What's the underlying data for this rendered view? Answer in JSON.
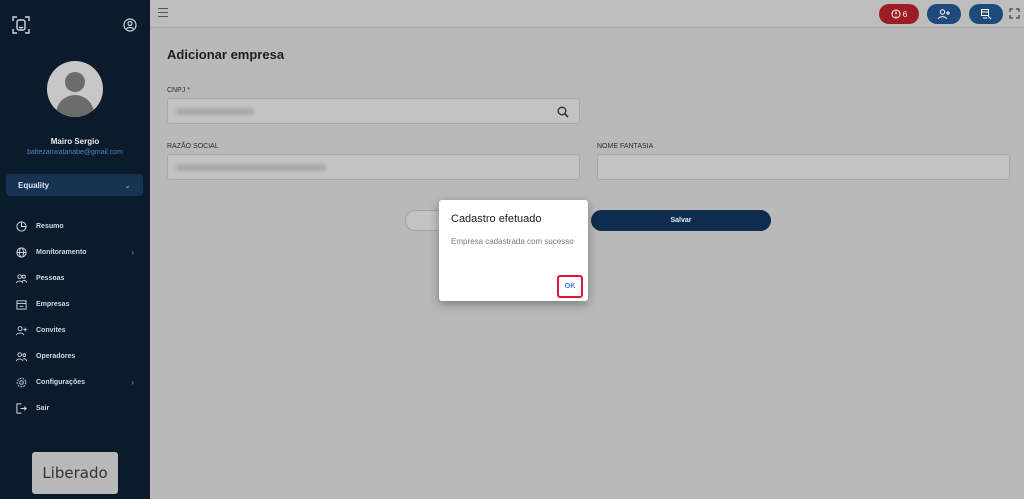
{
  "sidebar": {
    "user_name": "Mairo Sergio",
    "user_email": "baltezanwatanabe@gmail.com",
    "company": "Equality",
    "nav": [
      {
        "label": "Resumo",
        "icon": "pie-chart-icon",
        "has_submenu": false
      },
      {
        "label": "Monitoramento",
        "icon": "globe-icon",
        "has_submenu": true
      },
      {
        "label": "Pessoas",
        "icon": "people-icon",
        "has_submenu": false
      },
      {
        "label": "Empresas",
        "icon": "building-icon",
        "has_submenu": false
      },
      {
        "label": "Convites",
        "icon": "add-user-icon",
        "has_submenu": false
      },
      {
        "label": "Operadores",
        "icon": "operators-icon",
        "has_submenu": false
      },
      {
        "label": "Configurações",
        "icon": "gear-icon",
        "has_submenu": true
      },
      {
        "label": "Sair",
        "icon": "logout-icon",
        "has_submenu": false
      }
    ],
    "brand": "Liberado"
  },
  "topbar": {
    "alert_count": "6"
  },
  "main": {
    "title": "Adicionar empresa",
    "cnpj_label": "CNPJ *",
    "razao_label": "RAZÃO SOCIAL",
    "fantasia_label": "NOME FANTASIA",
    "save_label": "Salvar"
  },
  "modal": {
    "title": "Cadastro efetuado",
    "message": "Empresa cadastrada com sucesso",
    "ok_label": "OK"
  },
  "colors": {
    "sidebar_bg": "#0c1b2b",
    "primary": "#0e2c4e",
    "alert": "#9c1e24",
    "highlight": "#e0143c"
  }
}
